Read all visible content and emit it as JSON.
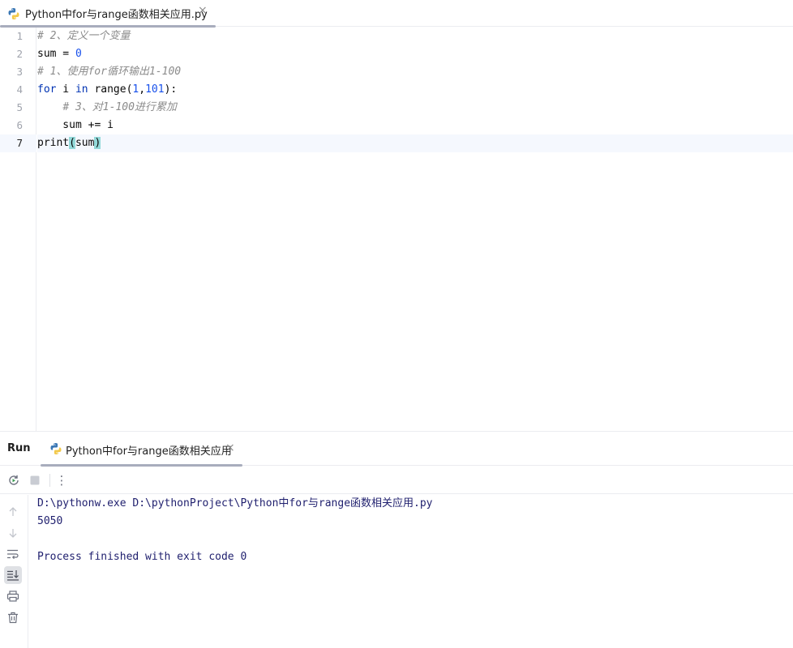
{
  "editor_tab": {
    "title": "Python中for与range函数相关应用.py",
    "close_glyph": "×"
  },
  "code_lines": [
    {
      "num": "1",
      "tokens": [
        {
          "t": "# 2、定义一个变量",
          "c": "comment"
        }
      ]
    },
    {
      "num": "2",
      "tokens": [
        {
          "t": "sum = ",
          "c": "plain"
        },
        {
          "t": "0",
          "c": "num"
        }
      ]
    },
    {
      "num": "3",
      "tokens": [
        {
          "t": "# 1、使用for循环输出1-100",
          "c": "comment"
        }
      ]
    },
    {
      "num": "4",
      "tokens": [
        {
          "t": "for",
          "c": "kw"
        },
        {
          "t": " i ",
          "c": "plain"
        },
        {
          "t": "in",
          "c": "kw"
        },
        {
          "t": " range(",
          "c": "plain"
        },
        {
          "t": "1",
          "c": "num"
        },
        {
          "t": ",",
          "c": "plain"
        },
        {
          "t": "101",
          "c": "num"
        },
        {
          "t": "):",
          "c": "plain"
        }
      ]
    },
    {
      "num": "5",
      "tokens": [
        {
          "t": "    ",
          "c": "plain"
        },
        {
          "t": "# 3、对1-100进行累加",
          "c": "comment"
        }
      ]
    },
    {
      "num": "6",
      "tokens": [
        {
          "t": "    sum += i",
          "c": "plain"
        }
      ]
    },
    {
      "num": "7",
      "tokens": [
        {
          "t": "print",
          "c": "plain"
        },
        {
          "t": "(",
          "c": "brace"
        },
        {
          "t": "sum",
          "c": "plain"
        },
        {
          "t": ")",
          "c": "brace"
        }
      ],
      "current": true
    }
  ],
  "run_panel": {
    "label": "Run",
    "tab_title": "Python中for与range函数相关应用",
    "close_glyph": "×",
    "toolbar": {
      "rerun_icon": "rerun-icon",
      "stop_icon": "stop-icon",
      "more_glyph": "⋮"
    },
    "side_tools": [
      "up-arrow-icon",
      "down-arrow-icon",
      "soft-wrap-icon",
      "scroll-to-end-icon",
      "print-icon",
      "trash-icon"
    ],
    "console_lines": [
      "D:\\pythonw.exe D:\\pythonProject\\Python中for与range函数相关应用.py",
      "5050",
      "",
      "Process finished with exit code 0"
    ]
  },
  "colors": {
    "keyword": "#0033b3",
    "number": "#1750eb",
    "comment": "#8c8c8c",
    "console_text": "#1f1f6e",
    "current_line_bg": "#f5f8fe",
    "brace_highlight": "#93d9d9"
  }
}
